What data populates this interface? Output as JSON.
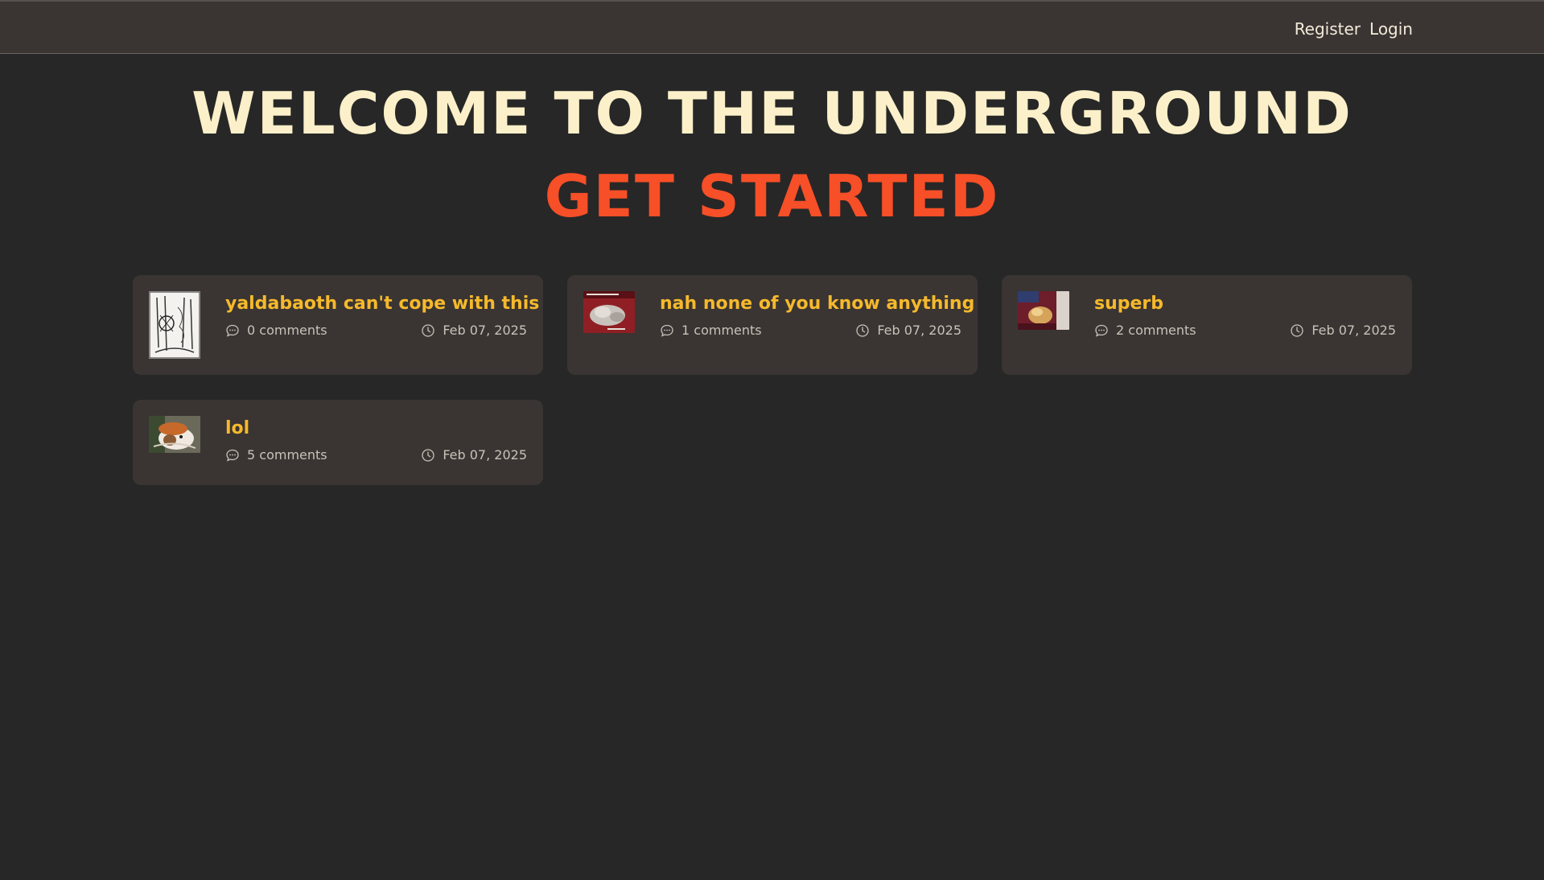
{
  "nav": {
    "register_label": "Register",
    "login_label": "Login"
  },
  "hero": {
    "title": "WELCOME TO THE UNDERGROUND",
    "cta": "GET STARTED"
  },
  "colors": {
    "background": "#272727",
    "topbar": "#3a3533",
    "card": "#3a3533",
    "title": "#fbf0c9",
    "cta": "#f74f27",
    "post_title": "#f6b92b",
    "meta": "#c8c2b8"
  },
  "icons": {
    "comments": "speech-bubble-icon",
    "date": "clock-icon"
  },
  "posts": [
    {
      "title": "yaldabaoth can't cope with this",
      "comments": "0 comments",
      "date": "Feb 07, 2025"
    },
    {
      "title": "nah none of you know anything",
      "comments": "1 comments",
      "date": "Feb 07, 2025"
    },
    {
      "title": "superb",
      "comments": "2 comments",
      "date": "Feb 07, 2025"
    },
    {
      "title": "lol",
      "comments": "5 comments",
      "date": "Feb 07, 2025"
    }
  ]
}
